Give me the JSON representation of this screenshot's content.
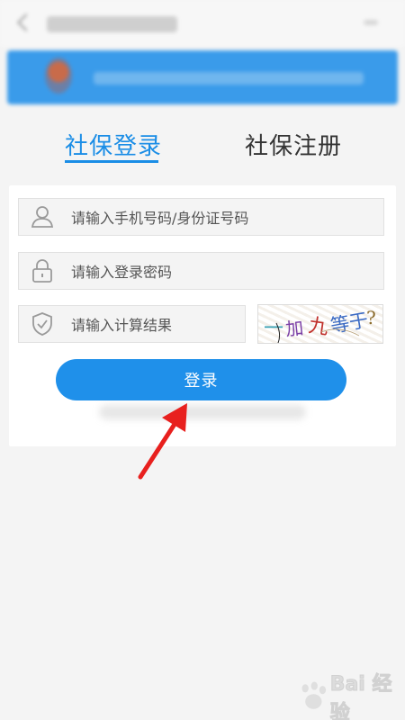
{
  "tabs": {
    "login": "社保登录",
    "register": "社保注册"
  },
  "form": {
    "phone_placeholder": "请输入手机号码/身份证号码",
    "password_placeholder": "请输入登录密码",
    "captcha_placeholder": "请输入计算结果",
    "captcha_text": [
      "一",
      "加",
      "九",
      "等于",
      "?"
    ]
  },
  "login_button": "登录",
  "colors": {
    "primary": "#1f90ea",
    "tab_active": "#1a8de6",
    "arrow": "#e8201e"
  },
  "icons": {
    "user": "user-icon",
    "lock": "lock-icon",
    "shield": "shield-check-icon"
  },
  "watermark": "Bai 经验"
}
